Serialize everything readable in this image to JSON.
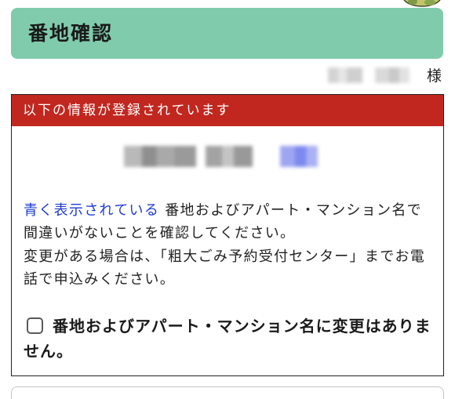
{
  "header": {
    "title": "番地確認",
    "background_color": "#80cbac"
  },
  "recipient": {
    "honorific": "様"
  },
  "registered_box": {
    "heading": "以下の情報が登録されています",
    "heading_color": "#c1271f"
  },
  "instructions": {
    "highlight": "青く表示されている",
    "sentence1_rest": " 番地およびアパート・マンション名で間違いがないことを確認してください。",
    "sentence2": "変更がある場合は、「粗大ごみ予約受付センター」までお電話で申込みください。",
    "highlight_color": "#1f3bd6"
  },
  "confirmation": {
    "label": "番地およびアパート・マンション名に変更はありません。",
    "checked": false
  },
  "icons": {
    "mascot": "mascot-character",
    "checkbox": "checkbox-unchecked"
  }
}
